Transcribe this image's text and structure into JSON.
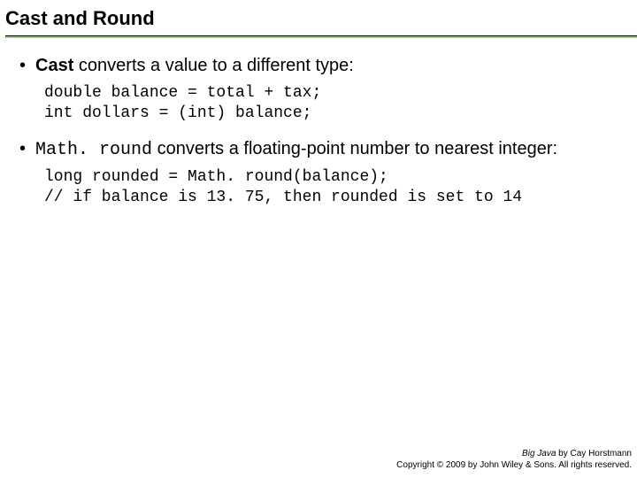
{
  "title": "Cast and Round",
  "bullets": {
    "b1_bold": "Cast",
    "b1_rest": " converts a value to a different type:",
    "b2_code": "Math. round",
    "b2_rest": "  converts a floating-point number to nearest integer:"
  },
  "code1": "double balance = total + tax;\nint dollars = (int) balance;",
  "code2": "long rounded = Math. round(balance);\n// if balance is 13. 75, then rounded is set to 14",
  "footer": {
    "book": "Big Java",
    "byline": " by Cay Horstmann",
    "copyright": "Copyright © 2009 by John Wiley & Sons. All rights reserved."
  }
}
